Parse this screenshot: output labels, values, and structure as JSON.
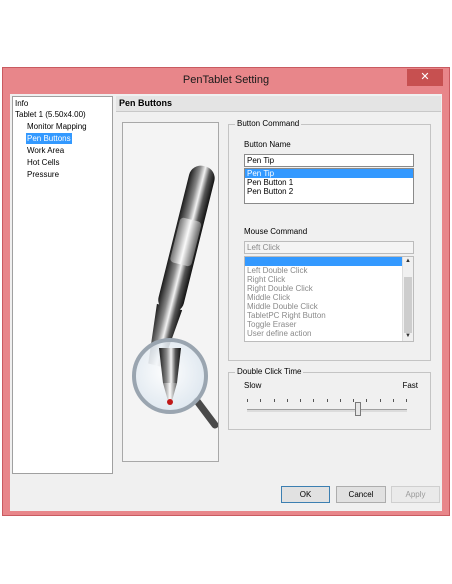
{
  "window": {
    "title": "PenTablet Setting"
  },
  "tree": {
    "items": [
      "Info",
      "Tablet  1 (5.50x4.00)",
      "Monitor Mapping",
      "Pen Buttons",
      "Work Area",
      "Hot Cells",
      "Pressure"
    ],
    "selected": "Pen Buttons"
  },
  "panel": {
    "header": "Pen Buttons"
  },
  "button_command": {
    "group_title": "Button Command",
    "name_label": "Button Name",
    "current_value": "Pen Tip",
    "options": [
      "Pen Tip",
      "Pen Button 1",
      "Pen Button 2"
    ],
    "selected": "Pen Tip"
  },
  "mouse_command": {
    "label": "Mouse Command",
    "current_value": "Left Click",
    "options": [
      "Left Click",
      "Left Double Click",
      "Right Click",
      "Right Double Click",
      "Middle Click",
      "Middle Double Click",
      "TabletPC Right Button",
      "Toggle Eraser",
      "User define action"
    ],
    "selected": "Left Click"
  },
  "double_click": {
    "group_title": "Double Click Time",
    "slow_label": "Slow",
    "fast_label": "Fast",
    "level": 0.7
  },
  "buttons": {
    "ok": "OK",
    "cancel": "Cancel",
    "apply": "Apply"
  },
  "colors": {
    "title_bar": "#e8868a",
    "close": "#c75050",
    "selection": "#3399ff"
  }
}
